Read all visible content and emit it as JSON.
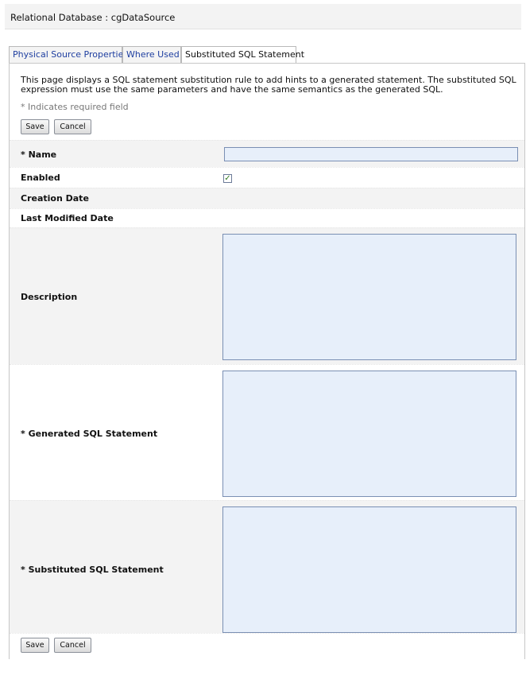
{
  "header": {
    "title": "Relational Database : cgDataSource"
  },
  "tabs": [
    {
      "label": "Physical Source Properties",
      "active": false
    },
    {
      "label": "Where Used",
      "active": false
    },
    {
      "label": "Substituted SQL Statement",
      "active": true
    }
  ],
  "intro_text": "This page displays a SQL statement substitution rule to add hints to a generated statement. The substituted SQL expression must use the same parameters and have the same semantics as the generated SQL.",
  "required_note": "* Indicates required field",
  "buttons": {
    "save": "Save",
    "cancel": "Cancel"
  },
  "form": {
    "name": {
      "label": "* Name",
      "value": ""
    },
    "enabled": {
      "label": "Enabled",
      "checked": true,
      "check_glyph": "✓"
    },
    "creation_date": {
      "label": "Creation Date",
      "value": ""
    },
    "last_modified_date": {
      "label": "Last Modified Date",
      "value": ""
    },
    "description": {
      "label": "Description",
      "value": ""
    },
    "generated_sql": {
      "label": "* Generated SQL Statement",
      "value": ""
    },
    "substituted_sql": {
      "label": "* Substituted SQL Statement",
      "value": ""
    }
  },
  "colors": {
    "input_bg": "#e7effa",
    "input_border": "#7a8fb3",
    "tab_link": "#1f3fa0",
    "row_shade": "#f3f3f3"
  }
}
